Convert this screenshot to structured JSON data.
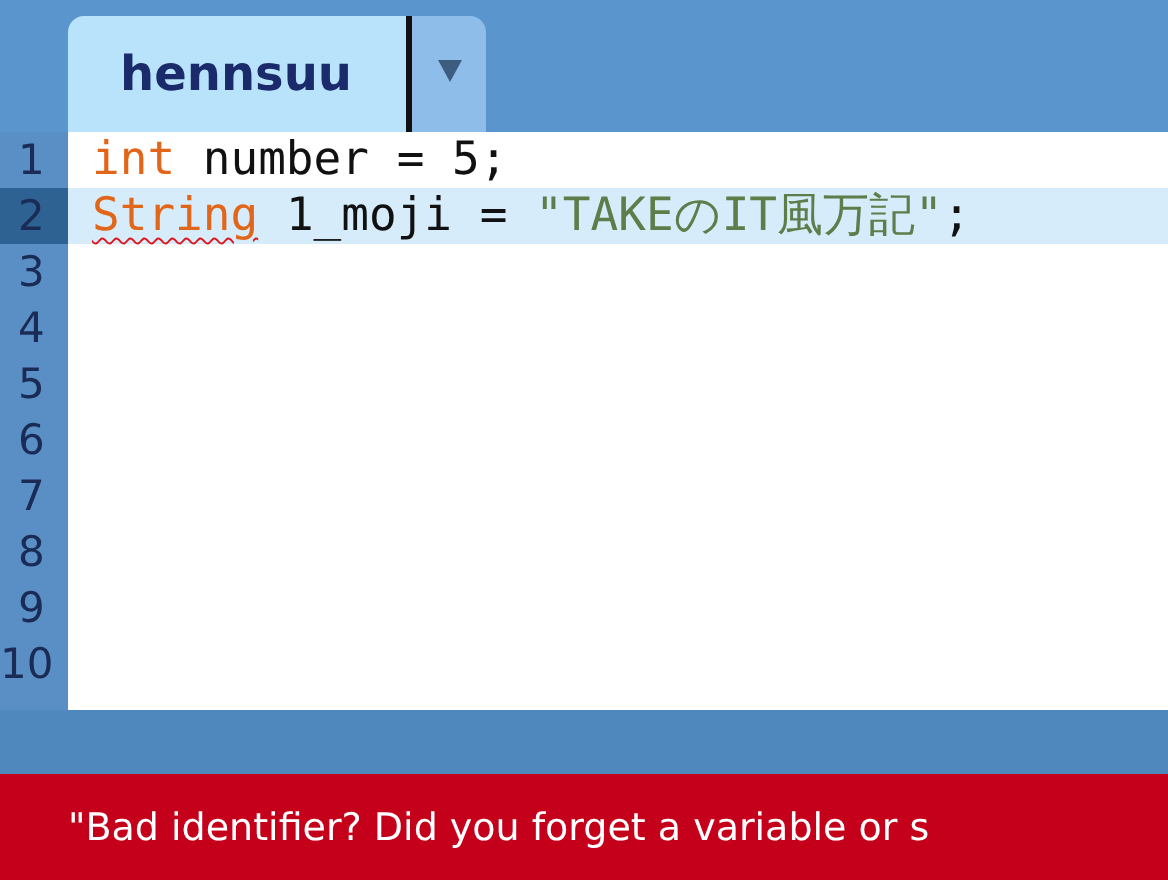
{
  "tabs": [
    {
      "label": "hennsuu",
      "selected": true
    }
  ],
  "editor": {
    "lines": [
      {
        "number": "1",
        "selected": false,
        "tokens": [
          {
            "text": "int",
            "kind": "keyword",
            "error": false
          },
          {
            "text": " number = 5;",
            "kind": "plain",
            "error": false
          }
        ]
      },
      {
        "number": "2",
        "selected": true,
        "tokens": [
          {
            "text": "String",
            "kind": "keyword",
            "error": true
          },
          {
            "text": " 1_moji = ",
            "kind": "plain",
            "error": false
          },
          {
            "text": "\"TAKEのIT風万記\"",
            "kind": "string",
            "error": false
          },
          {
            "text": ";",
            "kind": "plain",
            "error": false
          }
        ]
      },
      {
        "number": "3",
        "selected": false
      },
      {
        "number": "4",
        "selected": false
      },
      {
        "number": "5",
        "selected": false
      },
      {
        "number": "6",
        "selected": false
      },
      {
        "number": "7",
        "selected": false
      },
      {
        "number": "8",
        "selected": false
      },
      {
        "number": "9",
        "selected": false
      },
      {
        "number": "10",
        "selected": false
      }
    ]
  },
  "status_bar": {
    "message": "\"Bad identifier? Did you forget a variable or s"
  }
}
